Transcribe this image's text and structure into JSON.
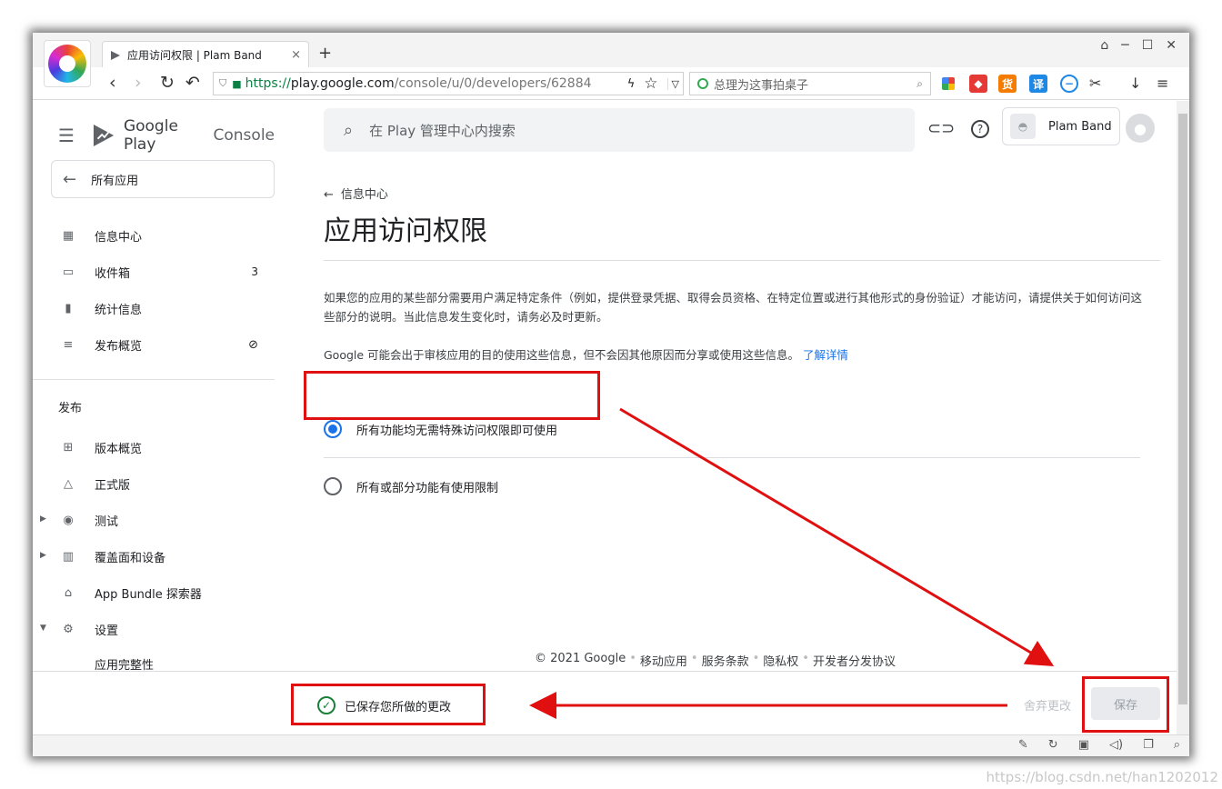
{
  "browser": {
    "tab_title": "应用访问权限 | Plam Band",
    "tab_close": "×",
    "new_tab": "+",
    "url_proto": "https://",
    "url_host": "play.google.com",
    "url_path": "/console/u/0/developers/62884",
    "search_placeholder": "总理为这事拍桌子",
    "ext_labels": [
      "货",
      "译"
    ],
    "ext_colors": [
      "#f57c00",
      "#1e88e5"
    ]
  },
  "sidebar": {
    "brand_google": "Google Play",
    "brand_console": " Console",
    "all_apps": "所有应用",
    "items": [
      {
        "label": "信息中心",
        "icon": "dashboard-icon",
        "badge": ""
      },
      {
        "label": "收件箱",
        "icon": "inbox-icon",
        "badge": "3"
      },
      {
        "label": "统计信息",
        "icon": "stats-icon",
        "badge": ""
      },
      {
        "label": "发布概览",
        "icon": "publish-overview-icon",
        "badge": ""
      }
    ],
    "section_publish": "发布",
    "publish_items": [
      {
        "label": "版本概览",
        "icon": "release-overview-icon"
      },
      {
        "label": "正式版",
        "icon": "production-icon"
      },
      {
        "label": "测试",
        "icon": "testing-icon"
      },
      {
        "label": "覆盖面和设备",
        "icon": "reach-devices-icon"
      },
      {
        "label": "App Bundle 探索器",
        "icon": "bundle-explorer-icon"
      },
      {
        "label": "设置",
        "icon": "settings-icon"
      }
    ],
    "sub_item": "应用完整性"
  },
  "header": {
    "search_placeholder": "在 Play 管理中心内搜索",
    "account_name": "Plam Band"
  },
  "main": {
    "breadcrumb": "信息中心",
    "title": "应用访问权限",
    "description_1": "如果您的应用的某些部分需要用户满足特定条件（例如，提供登录凭据、取得会员资格、在特定位置或进行其他形式的身份验证）才能访问，请提供关于如何访问这些部分的说明。当此信息发生变化时，请务必及时更新。",
    "description_2": "Google 可能会出于审核应用的目的使用这些信息，但不会因其他原因而分享或使用这些信息。",
    "learn_more": "了解详情",
    "option_1": "所有功能均无需特殊访问权限即可使用",
    "option_2": "所有或部分功能有使用限制",
    "selected_option": 1
  },
  "footer": {
    "copyright": "© 2021 Google",
    "links": [
      "移动应用",
      "服务条款",
      "隐私权",
      "开发者分发协议"
    ]
  },
  "savebar": {
    "saved_message": "已保存您所做的更改",
    "discard_label": "舍弃更改",
    "save_label": "保存"
  },
  "watermark": "https://blog.csdn.net/han1202012"
}
